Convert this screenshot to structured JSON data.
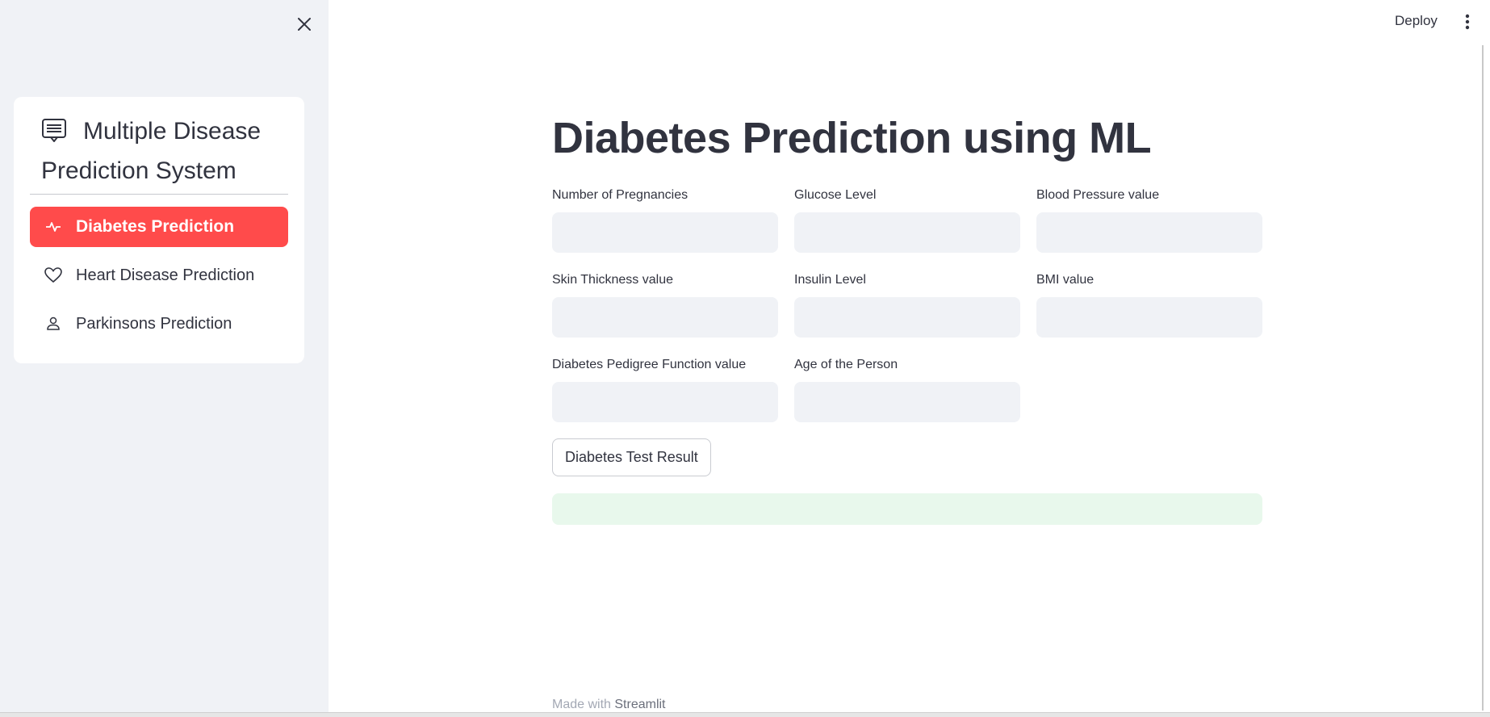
{
  "sidebar": {
    "header": "Multiple Disease Prediction System",
    "items": [
      {
        "label": "Diabetes Prediction",
        "icon": "activity-icon",
        "active": true
      },
      {
        "label": "Heart Disease Prediction",
        "icon": "heart-icon",
        "active": false
      },
      {
        "label": "Parkinsons Prediction",
        "icon": "person-icon",
        "active": false
      }
    ]
  },
  "header": {
    "deploy_label": "Deploy"
  },
  "main": {
    "title": "Diabetes Prediction using ML",
    "fields": [
      {
        "label": "Number of Pregnancies",
        "value": ""
      },
      {
        "label": "Glucose Level",
        "value": ""
      },
      {
        "label": "Blood Pressure value",
        "value": ""
      },
      {
        "label": "Skin Thickness value",
        "value": ""
      },
      {
        "label": "Insulin Level",
        "value": ""
      },
      {
        "label": "BMI value",
        "value": ""
      },
      {
        "label": "Diabetes Pedigree Function value",
        "value": ""
      },
      {
        "label": "Age of the Person",
        "value": ""
      }
    ],
    "button_label": "Diabetes Test Result",
    "result_text": ""
  },
  "footer": {
    "prefix": "Made with",
    "brand": "Streamlit"
  },
  "colors": {
    "accent": "#ff4b4b",
    "sidebar_bg": "#f0f2f6",
    "success_bg": "#e8f8ec"
  }
}
